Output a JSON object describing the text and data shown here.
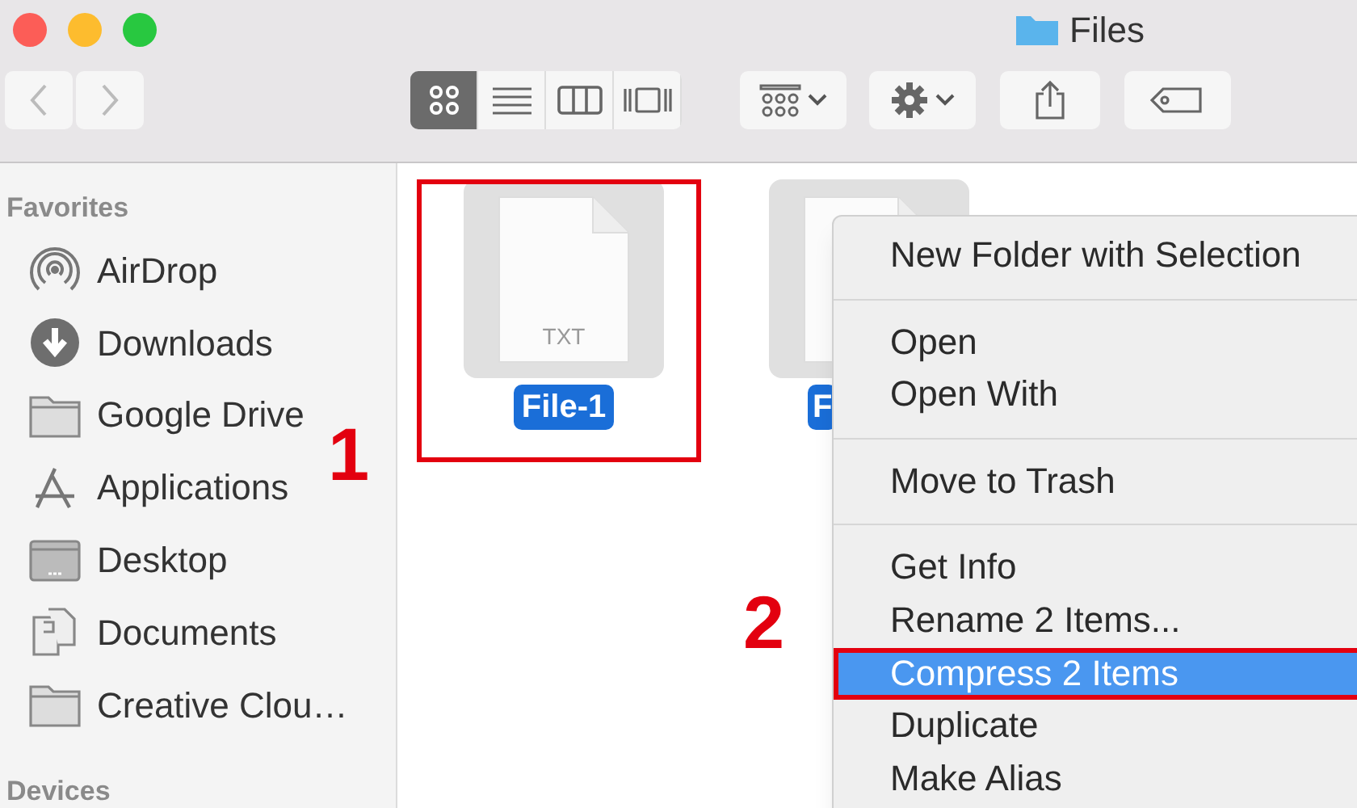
{
  "window": {
    "title": "Files"
  },
  "toolbar": {
    "view_modes": [
      {
        "kind": "icons",
        "selected": true
      },
      {
        "kind": "list",
        "selected": false
      },
      {
        "kind": "columns",
        "selected": false
      },
      {
        "kind": "gallery",
        "selected": false
      }
    ]
  },
  "sidebar": {
    "sections": [
      {
        "heading": "Favorites",
        "items": [
          {
            "label": "AirDrop",
            "kind": "airdrop"
          },
          {
            "label": "Downloads",
            "kind": "downloads"
          },
          {
            "label": "Google Drive",
            "kind": "folder"
          },
          {
            "label": "Applications",
            "kind": "apps"
          },
          {
            "label": "Desktop",
            "kind": "desktop"
          },
          {
            "label": "Documents",
            "kind": "documents"
          },
          {
            "label": "Creative Clou…",
            "kind": "folder"
          }
        ]
      },
      {
        "heading": "Devices"
      }
    ]
  },
  "files": [
    {
      "name": "File-1",
      "badge": "TXT",
      "selected": true,
      "outlined": true
    },
    {
      "name": "F",
      "selected": true,
      "outlined": false
    }
  ],
  "context_menu": {
    "groups": [
      [
        {
          "label": "New Folder with Selection",
          "selected": false,
          "outlined": false
        }
      ],
      [
        {
          "label": "Open",
          "selected": false,
          "outlined": false
        },
        {
          "label": "Open With",
          "selected": false,
          "outlined": false
        }
      ],
      [
        {
          "label": "Move to Trash",
          "selected": false,
          "outlined": false
        }
      ],
      [
        {
          "label": "Get Info",
          "selected": false,
          "outlined": false
        },
        {
          "label": "Rename 2 Items...",
          "selected": false,
          "outlined": false
        },
        {
          "label": "Compress 2 Items",
          "selected": true,
          "outlined": true
        },
        {
          "label": "Duplicate",
          "selected": false,
          "outlined": false
        },
        {
          "label": "Make Alias",
          "selected": false,
          "outlined": false
        }
      ]
    ]
  },
  "annotations": [
    {
      "label": "1"
    },
    {
      "label": "2"
    }
  ]
}
